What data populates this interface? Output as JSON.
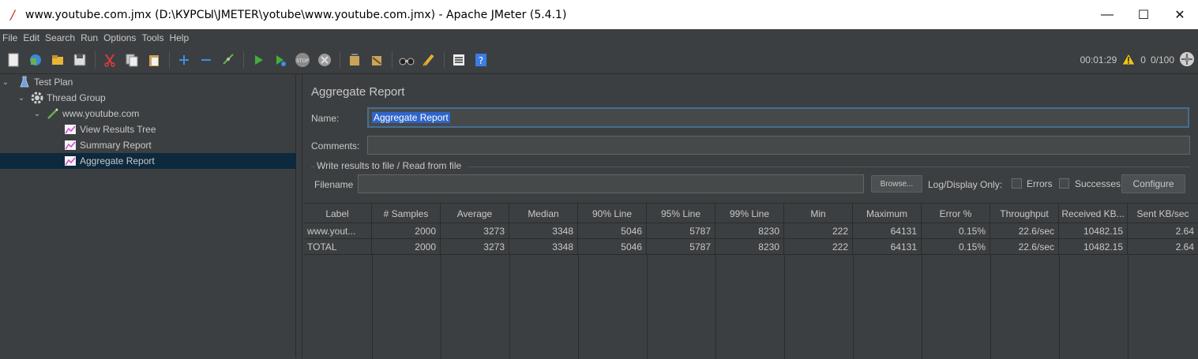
{
  "window": {
    "title": "www.youtube.com.jmx (D:\\КУРСЫ\\JMETER\\yotube\\www.youtube.com.jmx) - Apache JMeter (5.4.1)",
    "minimize": "—",
    "maximize": "☐",
    "close": "✕"
  },
  "menu": [
    "File",
    "Edit",
    "Search",
    "Run",
    "Options",
    "Tools",
    "Help"
  ],
  "status": {
    "elapsed": "00:01:29",
    "warnings": "0",
    "threads": "0/100"
  },
  "tree": {
    "items": [
      {
        "label": "Test Plan",
        "icon": "flask-icon"
      },
      {
        "label": "Thread Group",
        "icon": "gear-icon"
      },
      {
        "label": "www.youtube.com",
        "icon": "pipette-icon"
      },
      {
        "label": "View Results Tree",
        "icon": "chart-icon"
      },
      {
        "label": "Summary Report",
        "icon": "chart-icon"
      },
      {
        "label": "Aggregate Report",
        "icon": "chart-icon"
      }
    ]
  },
  "panel": {
    "title": "Aggregate Report",
    "name_label": "Name:",
    "name_value": "Aggregate Report",
    "comments_label": "Comments:",
    "comments_value": "",
    "group_title": "Write results to file / Read from file",
    "filename_label": "Filename",
    "filename_value": "",
    "browse": "Browse...",
    "log_display": "Log/Display Only:",
    "errors": "Errors",
    "successes": "Successes",
    "configure": "Configure"
  },
  "table": {
    "headers": [
      "Label",
      "# Samples",
      "Average",
      "Median",
      "90% Line",
      "95% Line",
      "99% Line",
      "Min",
      "Maximum",
      "Error %",
      "Throughput",
      "Received KB...",
      "Sent KB/sec"
    ],
    "rows": [
      [
        "www.yout...",
        "2000",
        "3273",
        "3348",
        "5046",
        "5787",
        "8230",
        "222",
        "64131",
        "0.15%",
        "22.6/sec",
        "10482.15",
        "2.64"
      ],
      [
        "TOTAL",
        "2000",
        "3273",
        "3348",
        "5046",
        "5787",
        "8230",
        "222",
        "64131",
        "0.15%",
        "22.6/sec",
        "10482.15",
        "2.64"
      ]
    ]
  },
  "colors": {
    "background": "#3c3f41",
    "selection": "#0d293e",
    "text_selection": "#2f65ca",
    "focus_border": "#466d94"
  }
}
